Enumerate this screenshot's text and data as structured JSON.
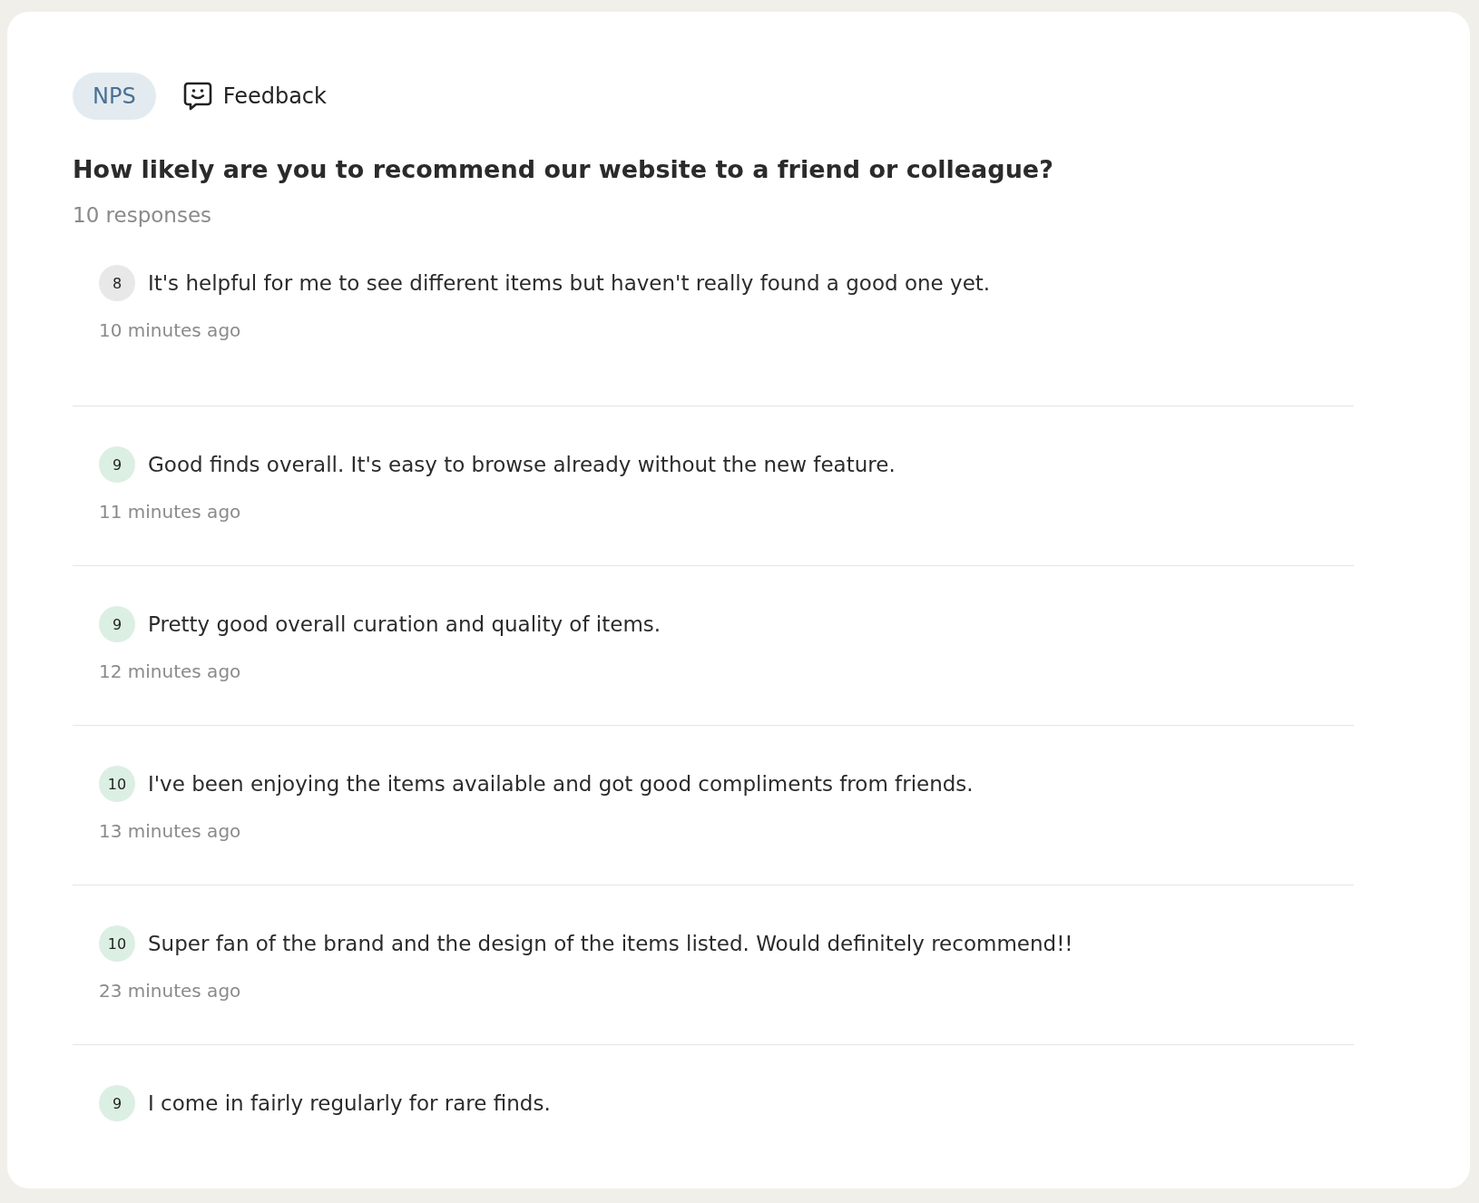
{
  "tabs": [
    {
      "label": "NPS",
      "selected": true
    },
    {
      "label": "Feedback",
      "selected": false
    }
  ],
  "question": "How likely are you to recommend our website to a friend or colleague?",
  "response_count": "10 responses",
  "responses": [
    {
      "score": "8",
      "color": "#e8e8e8",
      "comment": "It's helpful for me to see different items but haven't really found a good one yet.",
      "time": "10 minutes ago"
    },
    {
      "score": "9",
      "color": "#dcefe3",
      "comment": "Good finds overall. It's easy to browse already without the new feature.",
      "time": "11 minutes ago"
    },
    {
      "score": "9",
      "color": "#dcefe3",
      "comment": "Pretty good overall curation and quality of items.",
      "time": "12 minutes ago"
    },
    {
      "score": "10",
      "color": "#dcefe3",
      "comment": "I've been enjoying the items available and got good compliments from friends.",
      "time": "13 minutes ago"
    },
    {
      "score": "10",
      "color": "#dcefe3",
      "comment": "Super fan of the brand and the design of the items listed. Would definitely recommend!!",
      "time": "23 minutes ago"
    },
    {
      "score": "9",
      "color": "#dcefe3",
      "comment": "I come in fairly regularly for rare finds."
    }
  ]
}
